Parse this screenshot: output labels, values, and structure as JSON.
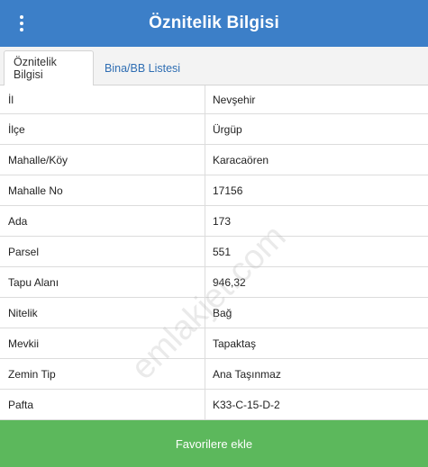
{
  "header": {
    "title": "Öznitelik Bilgisi",
    "menu_icon": "vertical-dots-icon"
  },
  "tabs": [
    {
      "label": "Öznitelik Bilgisi",
      "active": true
    },
    {
      "label": "Bina/BB Listesi",
      "active": false
    }
  ],
  "rows": [
    {
      "key": "İl",
      "value": "Nevşehir"
    },
    {
      "key": "İlçe",
      "value": "Ürgüp"
    },
    {
      "key": "Mahalle/Köy",
      "value": "Karacaören"
    },
    {
      "key": "Mahalle No",
      "value": "17156"
    },
    {
      "key": "Ada",
      "value": "173"
    },
    {
      "key": "Parsel",
      "value": "551"
    },
    {
      "key": "Tapu Alanı",
      "value": "946,32"
    },
    {
      "key": "Nitelik",
      "value": "Bağ"
    },
    {
      "key": "Mevkii",
      "value": "Tapaktaş"
    },
    {
      "key": "Zemin Tip",
      "value": "Ana Taşınmaz"
    },
    {
      "key": "Pafta",
      "value": "K33-C-15-D-2"
    }
  ],
  "watermark": "emlakjet.com",
  "footer": {
    "favorite_label": "Favorilere ekle"
  },
  "colors": {
    "header_bg": "#3c7fc8",
    "button_bg": "#5cb85c",
    "tab_link": "#2f6eb3"
  }
}
